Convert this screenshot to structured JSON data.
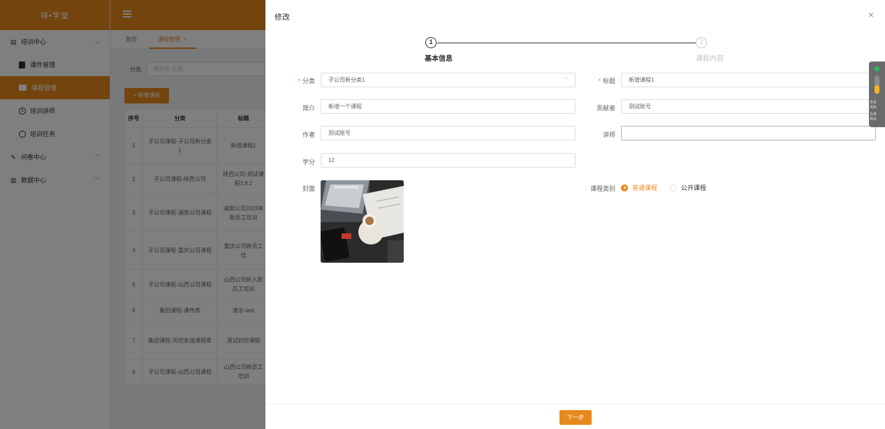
{
  "app": {
    "logo": "祥•学堂",
    "menu": [
      {
        "type": "group",
        "label": "培训中心",
        "icon": "document-icon",
        "expanded": true
      },
      {
        "type": "item",
        "label": "课件管理",
        "icon": "file-icon"
      },
      {
        "type": "item",
        "label": "课程管理",
        "icon": "file-icon",
        "active": true
      },
      {
        "type": "item",
        "label": "培训讲师",
        "icon": "user-icon"
      },
      {
        "type": "item",
        "label": "培训任务",
        "icon": "clock-icon"
      },
      {
        "type": "group",
        "label": "问卷中心",
        "icon": "edit-icon",
        "expanded": false
      },
      {
        "type": "group",
        "label": "数据中心",
        "icon": "chart-icon",
        "expanded": false
      }
    ],
    "tabs": {
      "home": "首页",
      "current": "课程管理",
      "close": "×"
    },
    "filter": {
      "label": "分类:",
      "placeholder": "请选择 分类"
    },
    "add_button": "+ 新增课程",
    "table": {
      "headers": [
        "序号",
        "分类",
        "标题"
      ],
      "rows": [
        [
          "1",
          "子公司课程-子公司新分类1",
          "新增课程1"
        ],
        [
          "2",
          "子公司课程-陕西公司",
          "陕西公司-测试课程3.8.2"
        ],
        [
          "3",
          "子公司课程-湖南公司课程",
          "湖南公司2023年新员工培训"
        ],
        [
          "4",
          "子公司课程-重庆公司课程",
          "重庆公司新员工培"
        ],
        [
          "5",
          "子公司课程-山西公司课程",
          "山西公司新入职员工培训"
        ],
        [
          "6",
          "集团课程-课件库",
          "演示-test"
        ],
        [
          "7",
          "集团课程-风控条线课程库",
          "测试封控课程"
        ],
        [
          "8",
          "子公司课程-山西公司课程",
          "山西公司新员工培训"
        ]
      ]
    }
  },
  "drawer": {
    "title": "修改",
    "close": "×",
    "steps": [
      {
        "number": "1",
        "label": "基本信息",
        "active": true
      },
      {
        "number": "2",
        "label": "课程内容",
        "active": false
      }
    ],
    "form": {
      "category": {
        "label": "分类",
        "value": "子公司新分类1",
        "required": true
      },
      "title": {
        "label": "标题",
        "value": "新增课程1",
        "required": true
      },
      "intro": {
        "label": "简介",
        "value": "新增一个课程"
      },
      "contributor": {
        "label": "贡献者",
        "value": "测试账号"
      },
      "author": {
        "label": "作者",
        "value": "测试账号"
      },
      "lecturer": {
        "label": "讲师",
        "value": ""
      },
      "credit": {
        "label": "学分",
        "value": "12"
      },
      "cover": {
        "label": "封面"
      },
      "course_type": {
        "label": "课程类别",
        "options": [
          "普通课程",
          "公开课程"
        ],
        "selected": "普通课程"
      }
    },
    "next_button": "下一步"
  },
  "widget": {
    "up": "0.0",
    "up_unit": "K/s",
    "down": "0.8",
    "down_unit": "K/s"
  },
  "colors": {
    "accent": "#e8891d",
    "required": "#f56c6c",
    "text": "#606266"
  }
}
